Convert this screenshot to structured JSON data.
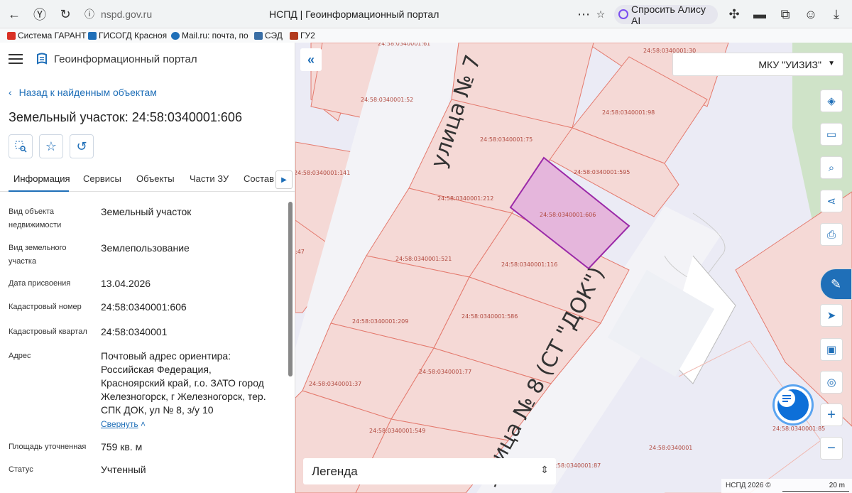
{
  "browser": {
    "url": "nspd.gov.ru",
    "tab_title": "НСПД | Геоинформационный портал",
    "alisa_label": "Спросить Алису AI",
    "bookmarks": [
      {
        "label": "Система ГАРАНТ",
        "color": "#d93025"
      },
      {
        "label": "ГИСОГД Красноя",
        "color": "#1f6fb8"
      },
      {
        "label": "Mail.ru: почта, по",
        "color": "#1f6fb8"
      },
      {
        "label": "СЭД",
        "color": "#3a6ea5"
      },
      {
        "label": "ГУ2",
        "color": "#b23a1e"
      }
    ]
  },
  "panel": {
    "portal_title": "Геоинформационный портал",
    "back_label": "Назад к найденным объектам",
    "object_title": "Земельный участок: 24:58:0340001:606",
    "tabs": [
      "Информация",
      "Сервисы",
      "Объекты",
      "Части ЗУ",
      "Состав"
    ],
    "active_tab": "Информация",
    "fields": [
      {
        "label": "Вид объекта недвижимости",
        "value": "Земельный участок"
      },
      {
        "label": "Вид земельного участка",
        "value": "Землепользование"
      },
      {
        "label": "Дата присвоения",
        "value": "13.04.2026"
      },
      {
        "label": "Кадастровый номер",
        "value": "24:58:0340001:606"
      },
      {
        "label": "Кадастровый квартал",
        "value": "24:58:0340001"
      },
      {
        "label": "Адрес",
        "value": "Почтовый адрес ориентира: Российская Федерация, Красноярский край, г.о. ЗАТО город Железногорск, г Железногорск, тер. СПК ДОК, ул № 8, з/у 10"
      },
      {
        "label": "Площадь уточненная",
        "value": "759 кв. м"
      },
      {
        "label": "Статус",
        "value": "Учтенный"
      }
    ],
    "collapse_label": "Свернуть"
  },
  "map": {
    "org_select": "МКУ \"УИЗИЗ\"",
    "legend_label": "Легенда",
    "copyright": "НСПД 2026 ©",
    "scale_label": "20 m",
    "street_labels": [
      "улица № 7",
      "улица № 8 (СТ \"ДОК\")"
    ],
    "parcel_labels": [
      "24:58:0340001:61",
      "24:58:0340001:30",
      "24:58:0340001:52",
      "24:58:0340001:98",
      "24:58:0340001:75",
      "24:58:0340001:595",
      "24:58:0340001:141",
      "24:58:0340001:212",
      "24:58:0340001:606",
      "24:58:0340001:521",
      "24:58:0340001:116",
      "24:58:0340001:586",
      "24:58:0340001:209",
      "24:58:0340001:77",
      "24:58:0340001:37",
      "24:58:0340001:549",
      "24:58:0340001:85",
      "24:58:0340001",
      "24:58:0340001:87",
      ":47"
    ],
    "colors": {
      "parcel_fill": "#f5d9d6",
      "parcel_stroke": "#e47a6e",
      "selected_fill": "#e5b6dc",
      "selected_stroke": "#9b2aa8",
      "accent": "#1f6fb8"
    }
  }
}
